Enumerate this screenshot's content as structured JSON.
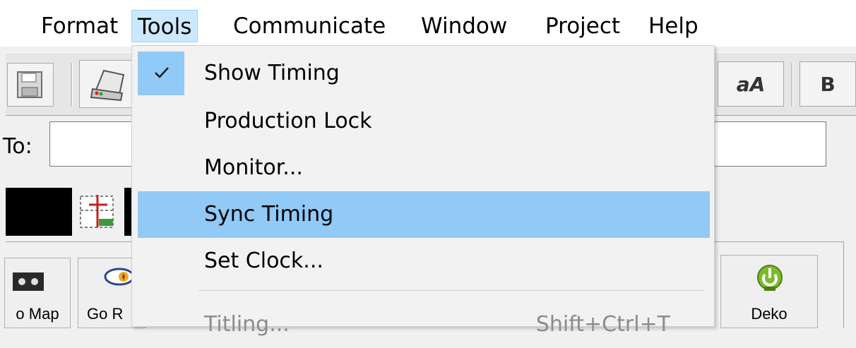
{
  "menubar": {
    "partial_left": "",
    "items": [
      {
        "label": "Format"
      },
      {
        "label": "Tools"
      },
      {
        "label": "Communicate"
      },
      {
        "label": "Window"
      },
      {
        "label": "Project"
      },
      {
        "label": "Help"
      }
    ]
  },
  "toolbar": {
    "font_case_label": "aA",
    "bold_label": "B"
  },
  "address": {
    "to_label": "To:",
    "to_value": ""
  },
  "panel": {
    "buttons": [
      {
        "label": "o Map"
      },
      {
        "label": "Go R"
      },
      {
        "label": "Deko"
      }
    ]
  },
  "tools_menu": {
    "items": [
      {
        "label": "Show Timing",
        "checked": true
      },
      {
        "label": "Production Lock"
      },
      {
        "label": "Monitor..."
      },
      {
        "label": "Sync Timing",
        "highlighted": true
      },
      {
        "label": "Set Clock..."
      },
      {
        "label": "Titling...",
        "shortcut": "Shift+Ctrl+T",
        "disabled": true
      }
    ]
  },
  "colors": {
    "menu_highlight": "#91c9f7",
    "menubar_hover": "#cce8ff",
    "deko_icon": "#7dbb2a"
  }
}
